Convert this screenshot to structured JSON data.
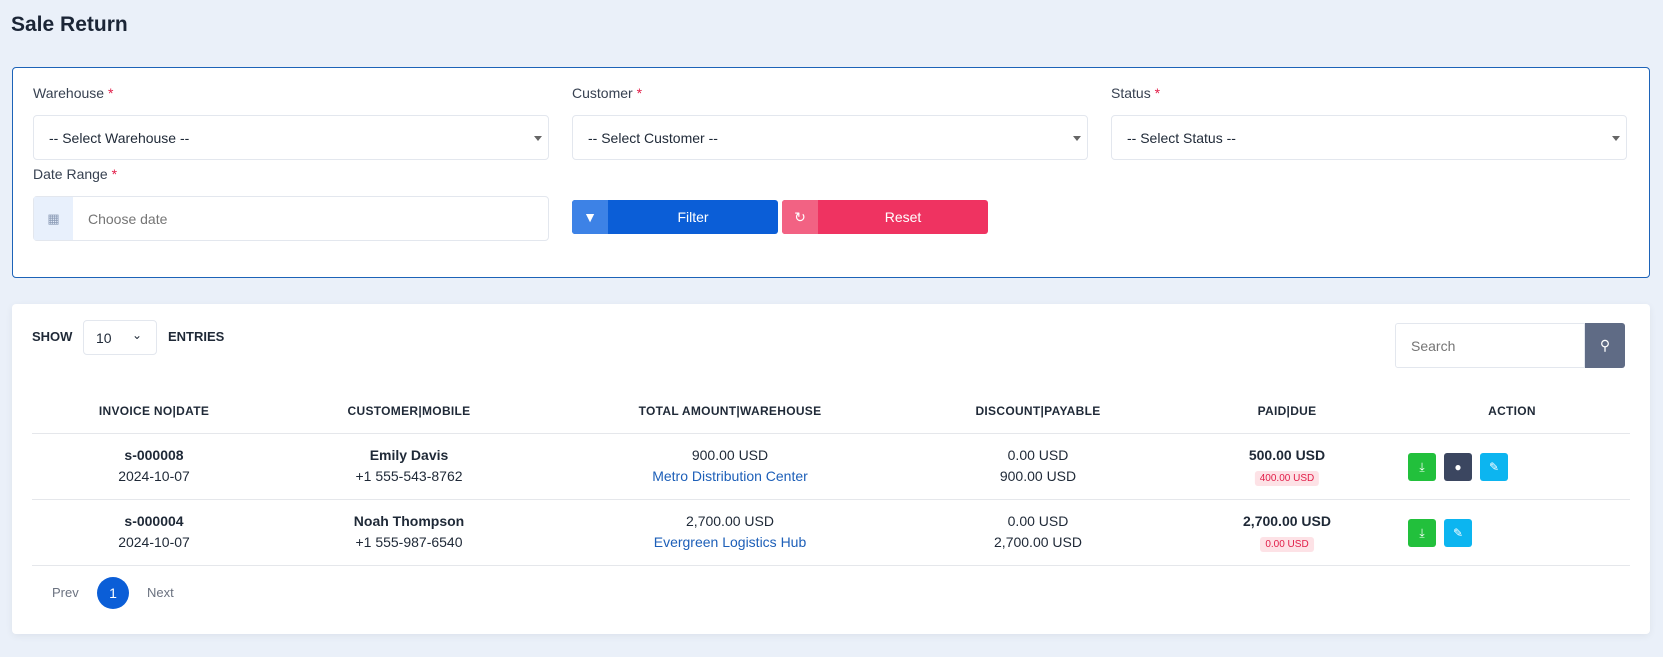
{
  "page_title": "Sale Return",
  "filters": {
    "warehouse": {
      "label": "Warehouse",
      "required": "*",
      "value": "-- Select Warehouse --"
    },
    "customer": {
      "label": "Customer",
      "required": "*",
      "value": "-- Select Customer --"
    },
    "status": {
      "label": "Status",
      "required": "*",
      "value": "-- Select Status --"
    },
    "date_range": {
      "label": "Date Range",
      "required": "*",
      "placeholder": "Choose date"
    },
    "filter_label": "Filter",
    "reset_label": "Reset"
  },
  "table_controls": {
    "show": "SHOW",
    "entries_value": "10",
    "entries": "ENTRIES",
    "search_placeholder": "Search"
  },
  "columns": [
    "INVOICE NO|DATE",
    "CUSTOMER|MOBILE",
    "TOTAL AMOUNT|WAREHOUSE",
    "DISCOUNT|PAYABLE",
    "PAID|DUE",
    "ACTION"
  ],
  "rows": [
    {
      "invoice": "s-000008",
      "date": "2024-10-07",
      "customer": "Emily Davis",
      "mobile": "+1 555-543-8762",
      "total": "900.00 USD",
      "warehouse": "Metro Distribution Center",
      "discount": "0.00 USD",
      "payable": "900.00 USD",
      "paid": "500.00 USD",
      "due": "400.00 USD"
    },
    {
      "invoice": "s-000004",
      "date": "2024-10-07",
      "customer": "Noah Thompson",
      "mobile": "+1 555-987-6540",
      "total": "2,700.00 USD",
      "warehouse": "Evergreen Logistics Hub",
      "discount": "0.00 USD",
      "payable": "2,700.00 USD",
      "paid": "2,700.00 USD",
      "due": "0.00 USD"
    }
  ],
  "pagination": {
    "prev": "Prev",
    "current": "1",
    "next": "Next"
  },
  "colors": {
    "primary": "#0b5ed7",
    "danger": "#ef3361",
    "success": "#22c03c"
  }
}
